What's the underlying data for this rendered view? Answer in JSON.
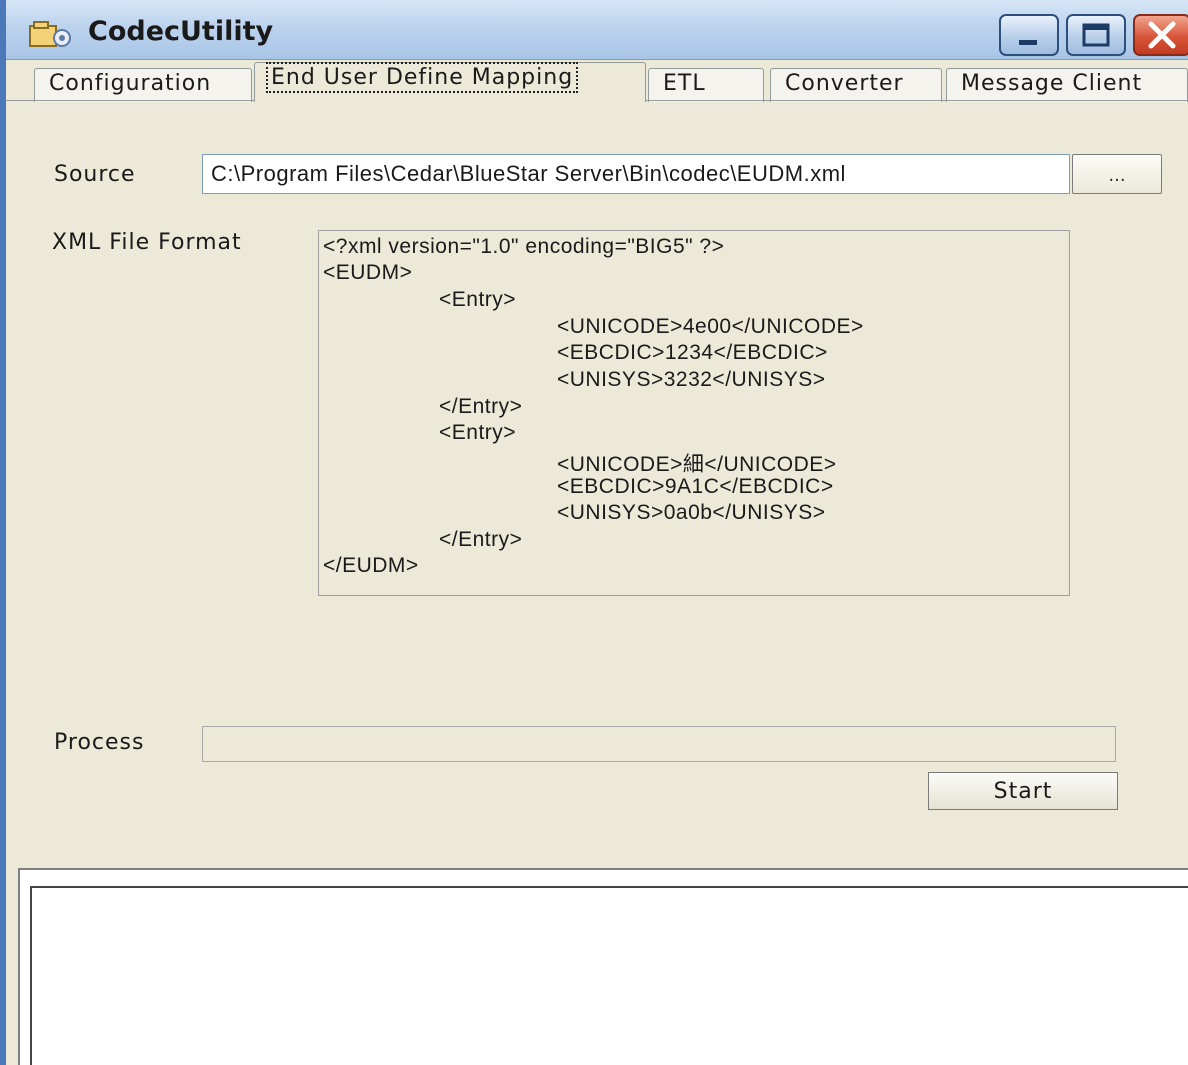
{
  "window": {
    "title": "CodecUtility",
    "icons": {
      "app": "app-icon",
      "minimize": "minimize-icon",
      "maximize": "maximize-icon",
      "close": "close-icon"
    }
  },
  "tabs": [
    {
      "label": "Configuration",
      "active": false
    },
    {
      "label": "End User Define Mapping",
      "active": true
    },
    {
      "label": "ETL",
      "active": false
    },
    {
      "label": "Converter",
      "active": false
    },
    {
      "label": "Message Client",
      "active": false
    }
  ],
  "form": {
    "source_label": "Source",
    "source_value": "C:\\Program Files\\Cedar\\BlueStar Server\\Bin\\codec\\EUDM.xml",
    "browse_label": "...",
    "xml_format_label": "XML File Format",
    "xml_lines": [
      "<?xml version=\"1.0\" encoding=\"BIG5\" ?>",
      "<EUDM>",
      "<Entry>",
      "<UNICODE>4e00</UNICODE>",
      "<EBCDIC>1234</EBCDIC>",
      "<UNISYS>3232</UNISYS>",
      "</Entry>",
      "<Entry>",
      "<UNICODE>細</UNICODE>",
      "<EBCDIC>9A1C</EBCDIC>",
      "<UNISYS>0a0b</UNISYS>",
      "</Entry>",
      "</EUDM>"
    ],
    "process_label": "Process",
    "start_label": "Start"
  },
  "colors": {
    "window_bg": "#ece9d8",
    "titlebar": "#bcd3ee",
    "close_button": "#d8553a"
  }
}
